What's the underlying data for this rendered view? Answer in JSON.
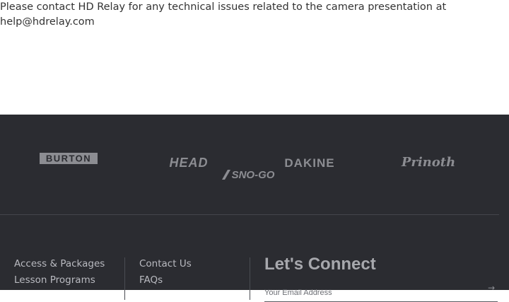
{
  "notice": {
    "text": "Please contact HD Relay for any technical issues related to the camera presentation at ",
    "email": "help@hdrelay.com"
  },
  "brands": [
    {
      "name": "BURTON"
    },
    {
      "name": "HEAD"
    },
    {
      "name": "SNO-GO"
    },
    {
      "name": "DAKINE"
    },
    {
      "name": "Prinoth"
    }
  ],
  "footer": {
    "col1": [
      "Access & Packages",
      "Lesson Programs"
    ],
    "col2": [
      "Contact Us",
      "FAQs"
    ],
    "connect": {
      "title": "Let's Connect",
      "email_placeholder": "Your Email Address"
    }
  },
  "colors": {
    "footer_bg": "#2b2c31",
    "link": "#b9bac0",
    "logo": "#8c8d92"
  }
}
